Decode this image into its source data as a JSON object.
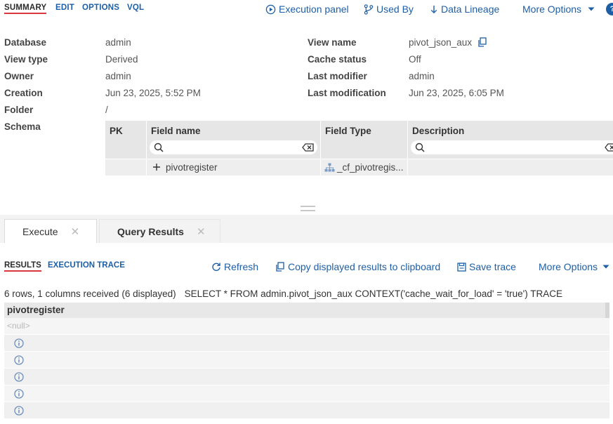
{
  "top_tabs": [
    "SUMMARY",
    "EDIT",
    "OPTIONS",
    "VQL"
  ],
  "top_actions": {
    "execution_panel": "Execution panel",
    "used_by": "Used By",
    "data_lineage": "Data Lineage",
    "more_options": "More Options",
    "help": "?"
  },
  "info": {
    "database_label": "Database",
    "database_value": "admin",
    "view_type_label": "View type",
    "view_type_value": "Derived",
    "owner_label": "Owner",
    "owner_value": "admin",
    "creation_label": "Creation",
    "creation_value": "Jun 23, 2025, 5:52 PM",
    "folder_label": "Folder",
    "folder_value": "/",
    "schema_label": "Schema",
    "view_name_label": "View name",
    "view_name_value": "pivot_json_aux",
    "cache_status_label": "Cache status",
    "cache_status_value": "Off",
    "last_modifier_label": "Last modifier",
    "last_modifier_value": "admin",
    "last_modification_label": "Last modification",
    "last_modification_value": "Jun 23, 2025, 6:05 PM"
  },
  "schema": {
    "headers": [
      "PK",
      "Field name",
      "Field Type",
      "Description"
    ],
    "row": {
      "field_name": "pivotregister",
      "field_type": "_cf_pivotregis..."
    }
  },
  "bottom_tabs": [
    "Execute",
    "Query Results"
  ],
  "results_tabs": [
    "RESULTS",
    "EXECUTION TRACE"
  ],
  "results_actions": {
    "refresh": "Refresh",
    "copy": "Copy displayed results to clipboard",
    "save_trace": "Save trace",
    "more_options": "More Options"
  },
  "summary": {
    "count": "6 rows, 1 columns received (6 displayed)",
    "query": "SELECT * FROM admin.pivot_json_aux CONTEXT('cache_wait_for_load' = 'true') TRACE"
  },
  "grid": {
    "column": "pivotregister",
    "null_text": "<null>",
    "rows": [
      "null",
      "info",
      "info",
      "info",
      "info",
      "info"
    ]
  },
  "colors": {
    "accent": "#1d5fa6",
    "active_underline": "#d9363e"
  }
}
